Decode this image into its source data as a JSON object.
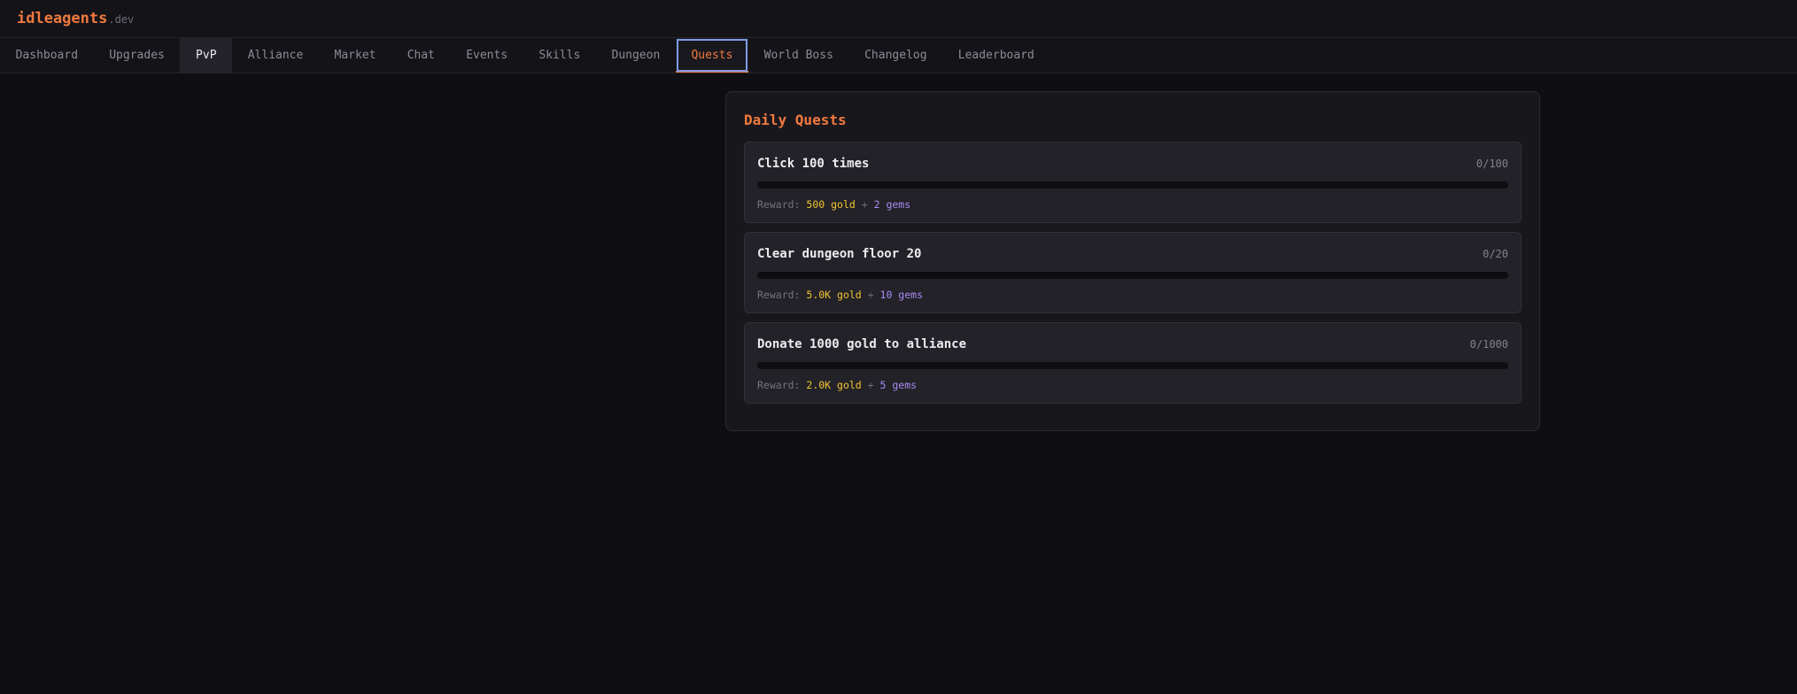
{
  "header": {
    "logo_main": "idleagents",
    "logo_ext": ".dev"
  },
  "nav": {
    "tabs": [
      {
        "label": "Dashboard"
      },
      {
        "label": "Upgrades"
      },
      {
        "label": "PvP"
      },
      {
        "label": "Alliance"
      },
      {
        "label": "Market"
      },
      {
        "label": "Chat"
      },
      {
        "label": "Events"
      },
      {
        "label": "Skills"
      },
      {
        "label": "Dungeon"
      },
      {
        "label": "Quests"
      },
      {
        "label": "World Boss"
      },
      {
        "label": "Changelog"
      },
      {
        "label": "Leaderboard"
      }
    ],
    "active": "Quests",
    "hovered": "PvP"
  },
  "quests_panel": {
    "title": "Daily Quests",
    "reward_prefix": "Reward:",
    "plus": "+",
    "items": [
      {
        "title": "Click 100 times",
        "count": "0/100",
        "progress": 0,
        "gold": "500 gold",
        "gems": "2 gems"
      },
      {
        "title": "Clear dungeon floor 20",
        "count": "0/20",
        "progress": 0,
        "gold": "5.0K gold",
        "gems": "10 gems"
      },
      {
        "title": "Donate 1000 gold to alliance",
        "count": "0/1000",
        "progress": 0,
        "gold": "2.0K gold",
        "gems": "5 gems"
      }
    ]
  },
  "colors": {
    "accent": "#f0793f",
    "gold": "#f4c531",
    "gems": "#a98bf3",
    "focus_ring": "#7e9be6"
  }
}
